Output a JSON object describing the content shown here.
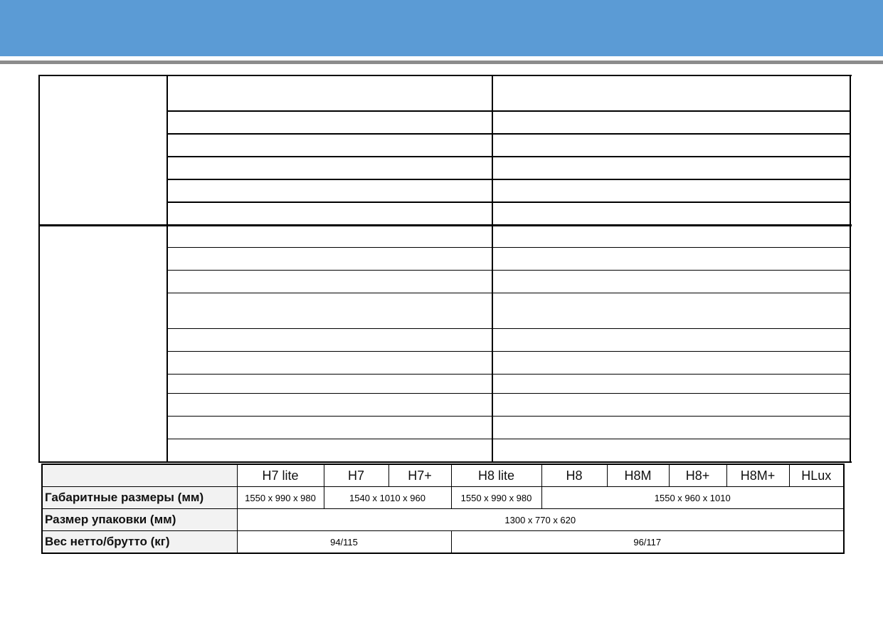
{
  "models": [
    "H7 lite",
    "H7",
    "H7+",
    "H8 lite",
    "H8",
    "H8M",
    "H8+",
    "H8M+",
    "HLux"
  ],
  "rows": {
    "dimensions": {
      "label": "Габаритные размеры (мм)",
      "values": [
        "1550 x 990 x 980",
        "1540 x 1010 x 960",
        "1550 x 990 x 980",
        "1550 x 960 x 1010"
      ]
    },
    "package": {
      "label": "Размер упаковки (мм)",
      "value": "1300 x 770 x 620"
    },
    "weight": {
      "label": "Вес нетто/брутто (кг)",
      "values": [
        "94/115",
        "96/117"
      ]
    }
  },
  "colors": {
    "banner": "#5b9bd5",
    "banner_rule": "#8c8c8c",
    "label_bg": "#f2f2f2"
  }
}
